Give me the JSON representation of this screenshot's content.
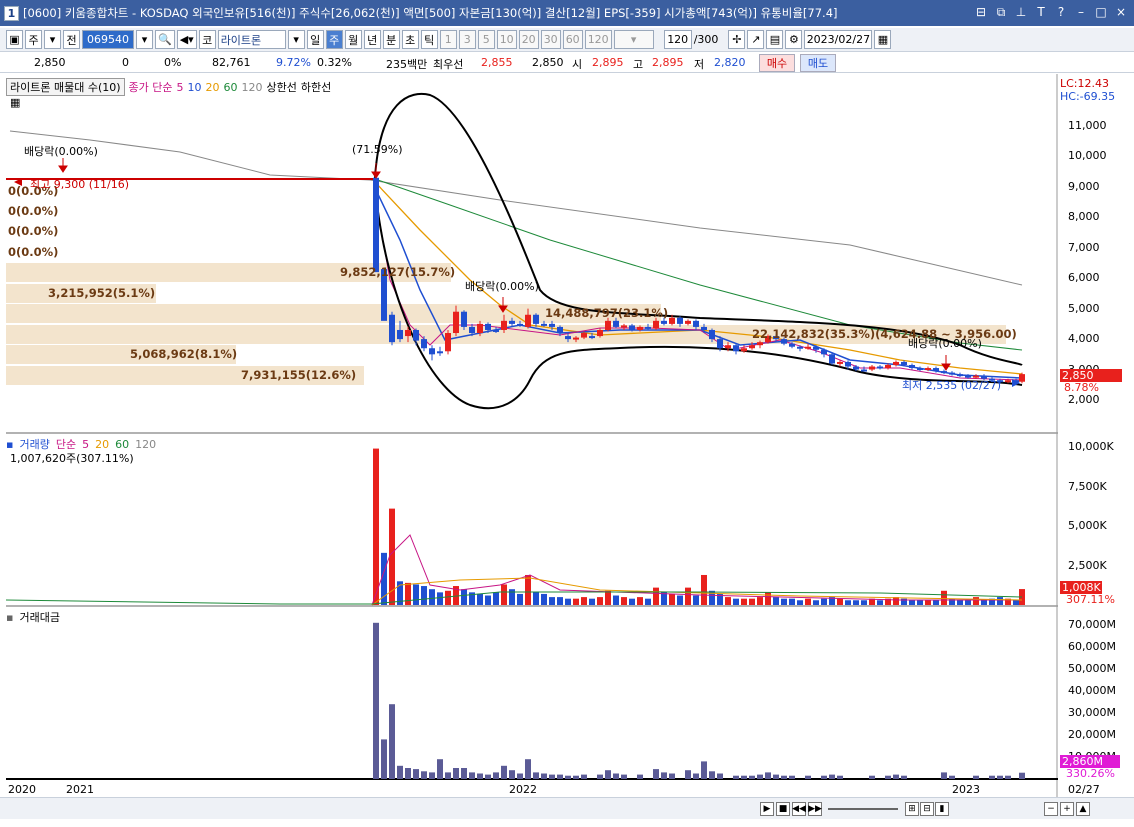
{
  "window": {
    "index": "1",
    "title": "[0600] 키움종합차트 - KOSDAQ 외국인보유[516(천)] 주식수[26,062(천)] 액면[500] 자본금[130(억)] 결산[12월] EPS[-359] 시가총액[743(억)] 유통비율[77.4]"
  },
  "toolbar": {
    "mode1": "주",
    "mode2": "전",
    "code": "069540",
    "market": "코",
    "stock_name": "라이트론",
    "periods": [
      "일",
      "주",
      "월",
      "년",
      "분",
      "초",
      "틱"
    ],
    "selected_period": "주",
    "intervals": [
      "1",
      "3",
      "5",
      "10",
      "20",
      "30",
      "60",
      "120"
    ],
    "count": "120",
    "count_max": "/300",
    "date": "2023/02/27"
  },
  "info": {
    "price": "2,850",
    "change": "0",
    "change_pct": "0%",
    "volume": "82,761",
    "turnover_pct": "9.72%",
    "ratio": "0.32%",
    "amount": "235백만",
    "best_ask_label": "최우선",
    "best_ask": "2,855",
    "best_bid": "2,850",
    "open_label": "시",
    "open": "2,895",
    "high_label": "고",
    "high": "2,895",
    "low_label": "저",
    "low": "2,820",
    "buy": "매수",
    "sell": "매도"
  },
  "price_panel": {
    "title_box": "라이트론 매물대 수(10)",
    "legend_prefix": "종가 단순",
    "ma": [
      {
        "p": "5",
        "color": "#c71585"
      },
      {
        "p": "10",
        "color": "#1f4fd1"
      },
      {
        "p": "20",
        "color": "#e69a00"
      },
      {
        "p": "60",
        "color": "#1e8a3a"
      },
      {
        "p": "120",
        "color": "#888888"
      }
    ],
    "upper_lbl": "상한선",
    "lower_lbl": "하한선",
    "lc": "LC:12.43",
    "hc": "HC:-69.35",
    "yticks": [
      "11,000",
      "10,000",
      "9,000",
      "8,000",
      "7,000",
      "6,000",
      "5,000",
      "4,000",
      "3,000",
      "2,000"
    ],
    "current_tag": "2,850",
    "pct_tag": "8.78%",
    "annotations": {
      "div1": "배당락(0.00%)",
      "high": "최고 9,300 (11/16)",
      "drop": "(71.59%)",
      "div2": "배당락(0.00%)",
      "div3": "배당락(0.00%)",
      "low": "최저 2,535 (02/27)"
    },
    "vol_profile": [
      {
        "label": "0(0.0%)"
      },
      {
        "label": "0(0.0%)"
      },
      {
        "label": "0(0.0%)"
      },
      {
        "label": "0(0.0%)"
      },
      {
        "label": "9,852,127(15.7%)"
      },
      {
        "label": "3,215,952(5.1%)"
      },
      {
        "label": "14,488,797(23.1%)"
      },
      {
        "label": "22,142,832(35.3%)(4,624.88 ~ 3,956.00)"
      },
      {
        "label": "5,068,962(8.1%)"
      },
      {
        "label": "7,931,155(12.6%)"
      }
    ]
  },
  "volume_panel": {
    "title": "거래량",
    "legend_prefix": "단순",
    "ma": [
      "5",
      "20",
      "60",
      "120"
    ],
    "last": "1,007,620주(307.11%)",
    "yticks": [
      "10,000K",
      "7,500K",
      "5,000K",
      "2,500K"
    ],
    "tag1": "1,008K",
    "tag2": "307.11%"
  },
  "amount_panel": {
    "title": "거래대금",
    "yticks": [
      "70,000M",
      "60,000M",
      "50,000M",
      "40,000M",
      "30,000M",
      "20,000M",
      "10,000M"
    ],
    "tag1": "2,860M",
    "tag2": "330.26%"
  },
  "dates": [
    "2020",
    "2021",
    "2022",
    "2023",
    "02/27"
  ],
  "colors": {
    "up": "#e8211d",
    "down": "#1f4fd1",
    "profile": "#f3e4cd",
    "titlebar": "#3b5fa0"
  }
}
